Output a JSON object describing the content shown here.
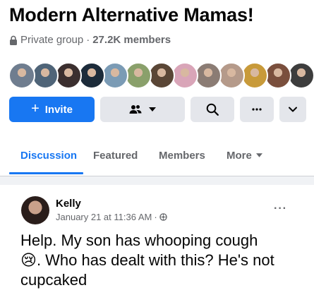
{
  "group": {
    "title": "Modern Alternative Mamas!",
    "privacy": "Private group",
    "separator": "·",
    "member_count": "27.2K members"
  },
  "member_avatars": [
    {
      "color": "#6f7d8f"
    },
    {
      "color": "#4f6478"
    },
    {
      "color": "#3b2f2f"
    },
    {
      "color": "#1c2b3a"
    },
    {
      "color": "#7b9bb5"
    },
    {
      "color": "#8aa06b"
    },
    {
      "color": "#5a4636"
    },
    {
      "color": "#d9a5b8"
    },
    {
      "color": "#8b7c74"
    },
    {
      "color": "#b59a8a"
    },
    {
      "color": "#c89a3a"
    },
    {
      "color": "#7a4f3d"
    },
    {
      "color": "#3d3d3d"
    }
  ],
  "actions": {
    "invite_label": "Invite",
    "colors": {
      "primary": "#1877f2",
      "secondary": "#e4e6eb"
    }
  },
  "tabs": [
    {
      "label": "Discussion",
      "active": true
    },
    {
      "label": "Featured",
      "active": false
    },
    {
      "label": "Members",
      "active": false
    },
    {
      "label": "More",
      "active": false
    }
  ],
  "post": {
    "author": "Kelly",
    "timestamp": "January 21 at 11:36 AM",
    "separator": "·",
    "body_line1": "Help. My son has whooping cough",
    "body_emoji": "😢",
    "body_line2": ". Who has dealt with this? He's not cupcaked"
  }
}
